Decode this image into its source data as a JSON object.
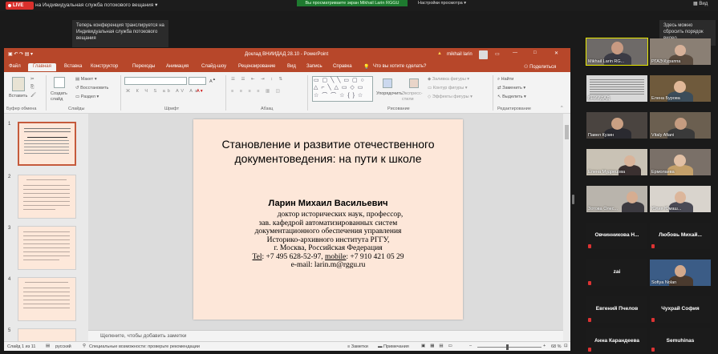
{
  "zoom": {
    "live_label": "LIVE",
    "stream_label": "на Индивидуальная служба потокового вещания",
    "viewing_label": "Вы просматриваете экран Mikhail Larin RGGU",
    "view_options": "Настройки просмотра",
    "view_button": "Вид",
    "tooltip_stream": "Теперь конференция транслируется на Индивидуальная служба потокового вещания",
    "tooltip_reset": "Здесь можно сбросить порядок видео"
  },
  "pp": {
    "title": "Доклад ВНИИДАД 28.10 - PowerPoint",
    "warning": "mikhail larin",
    "share": "Поделиться",
    "tabs": [
      "Файл",
      "Главная",
      "Вставка",
      "Конструктор",
      "Переходы",
      "Анимация",
      "Слайд-шоу",
      "Рецензирование",
      "Вид",
      "Запись",
      "Справка",
      "Что вы хотите сделать?"
    ],
    "ribbon": {
      "paste": "Вставить",
      "clipboard": "Буфер обмена",
      "new_slide": "Создать слайд",
      "layout": "Макет",
      "reset": "Восстановить",
      "section": "Раздел",
      "slides": "Слайды",
      "font": "Шрифт",
      "paragraph": "Абзац",
      "arrange": "Упорядочить",
      "quick_styles": "Экспресс-стили",
      "fill": "Заливка фигуры",
      "outline": "Контур фигуры",
      "effects": "Эффекты фигуры",
      "drawing": "Рисование",
      "find": "Найти",
      "replace": "Заменить",
      "select": "Выделить",
      "editing": "Редактирование"
    },
    "thumb_numbers": [
      "1",
      "2",
      "3",
      "4",
      "5"
    ],
    "slide": {
      "title": "Становление и развитие отечественного документоведения: на пути к школе",
      "author": "Ларин Михаил Васильевич",
      "lines": [
        "доктор исторических наук, профессор,",
        "зав. кафедрой автоматизированных систем",
        "документационного обеспечения управления",
        "Историко-архивного института РГГУ,",
        "г. Москва, Российская Федерация"
      ],
      "tel_label": "Tel",
      "tel_value": ": +7 495 628-52-97, ",
      "mobile_label": "mobile",
      "mobile_value": ": +7 910 421 05 29",
      "email": "e-mail: larin.m@rggu.ru"
    },
    "notes_placeholder": "Щелкните, чтобы добавить заметки",
    "status": {
      "slide_count": "Слайд 1 из 11",
      "language": "русский",
      "accessibility": "Специальные возможности: проверьте рекомендации",
      "notes": "Заметки",
      "comments": "Примечания",
      "zoom": "68 %"
    }
  },
  "participants": [
    {
      "name": "Mikhail Larin RG..."
    },
    {
      "name": "РГАЭ Кураппа"
    },
    {
      "name": "ВНИИДАД"
    },
    {
      "name": "Елена Бурова"
    },
    {
      "name": "Павел Кузин"
    },
    {
      "name": "Vitaly Afiani"
    },
    {
      "name": "Елена Мудрецова"
    },
    {
      "name": "Ермолаева"
    },
    {
      "name": "Зотова Олес..."
    },
    {
      "name": "Юлия Юмаш..."
    },
    {
      "name": "Овчинникова Н..."
    },
    {
      "name": "Любовь Михай..."
    },
    {
      "name": "zai"
    },
    {
      "name": "Sofiya Nolan"
    },
    {
      "name": "Евгений Пчелов"
    },
    {
      "name": "Чухрай София"
    },
    {
      "name": "Анна Карандеева"
    },
    {
      "name": "Semuhinas"
    }
  ],
  "colors": {
    "ppt_accent": "#b7472a",
    "live": "#d9302c",
    "viewing": "#1e7a2f"
  }
}
